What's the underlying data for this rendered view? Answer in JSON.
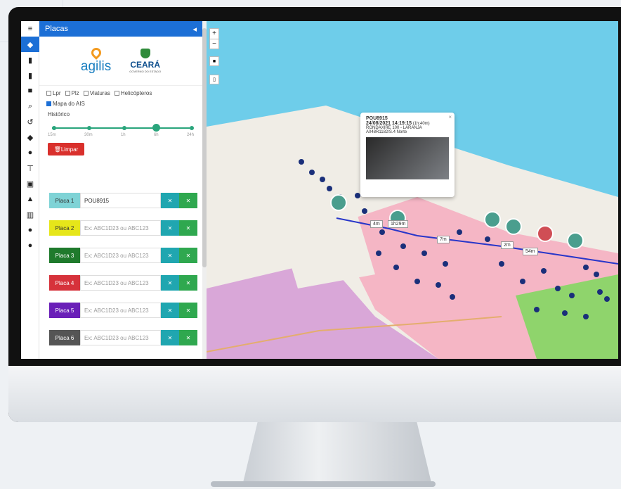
{
  "panel": {
    "title": "Placas",
    "collapse_icon": "◂"
  },
  "logos": {
    "agilis": "agilis",
    "ceara": "CEARÁ",
    "ceara_sub": "GOVERNO DO ESTADO"
  },
  "filters": [
    {
      "label": "Lpr",
      "checked": false
    },
    {
      "label": "Plz",
      "checked": false
    },
    {
      "label": "Viaturas",
      "checked": false
    },
    {
      "label": "Helicópteros",
      "checked": false
    },
    {
      "label": "Mapa do AIS",
      "checked": true
    }
  ],
  "history": {
    "label": "Histórico",
    "ticks": [
      "15m",
      "30m",
      "1h",
      "6h",
      "24h"
    ],
    "selected_index": 3
  },
  "clear_button": "Limpar",
  "plates": [
    {
      "label": "Placa 1",
      "value": "POU8915",
      "placeholder": "",
      "color": "#7fd3d6",
      "text_color": "#333"
    },
    {
      "label": "Placa 2",
      "value": "",
      "placeholder": "Ex: ABC1D23 ou ABC123",
      "color": "#e6e61a",
      "text_color": "#333"
    },
    {
      "label": "Placa 3",
      "value": "",
      "placeholder": "Ex: ABC1D23 ou ABC123",
      "color": "#1f7a2c",
      "text_color": "#fff"
    },
    {
      "label": "Placa 4",
      "value": "",
      "placeholder": "Ex: ABC1D23 ou ABC123",
      "color": "#d6323b",
      "text_color": "#fff"
    },
    {
      "label": "Placa 5",
      "value": "",
      "placeholder": "Ex: ABC1D23 ou ABC123",
      "color": "#6a1fb8",
      "text_color": "#fff"
    },
    {
      "label": "Placa 6",
      "value": "",
      "placeholder": "Ex: ABC1D23 ou ABC123",
      "color": "#555555",
      "text_color": "#fff"
    }
  ],
  "zoom": {
    "in": "+",
    "out": "−"
  },
  "popup": {
    "plate": "POU8915",
    "datetime": "24/08/2021 14:19:15",
    "duration": "(1h:40m)",
    "location": "RONDAXIRE 100 - LARANJA",
    "camera": "A048R1182/S.4 Norte"
  },
  "durations": [
    "4m",
    "1h29m",
    "7m",
    "2m",
    "54m"
  ]
}
